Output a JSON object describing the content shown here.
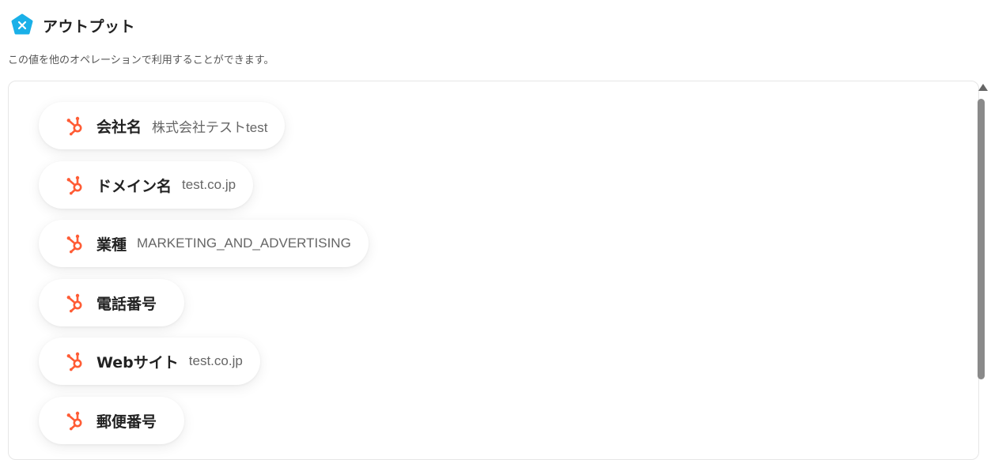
{
  "header": {
    "title": "アウトプット",
    "description": "この値を他のオペレーションで利用することができます。"
  },
  "outputs": [
    {
      "label": "会社名",
      "value": "株式会社テストtest",
      "icon": "hubspot-icon"
    },
    {
      "label": "ドメイン名",
      "value": "test.co.jp",
      "icon": "hubspot-icon"
    },
    {
      "label": "業種",
      "value": "MARKETING_AND_ADVERTISING",
      "icon": "hubspot-icon"
    },
    {
      "label": "電話番号",
      "value": "",
      "icon": "hubspot-icon"
    },
    {
      "label": "Webサイト",
      "value": "test.co.jp",
      "icon": "hubspot-icon"
    },
    {
      "label": "郵便番号",
      "value": "",
      "icon": "hubspot-icon"
    }
  ],
  "colors": {
    "badge": "#1ab0e8",
    "hubspot": "#ff5c35"
  }
}
